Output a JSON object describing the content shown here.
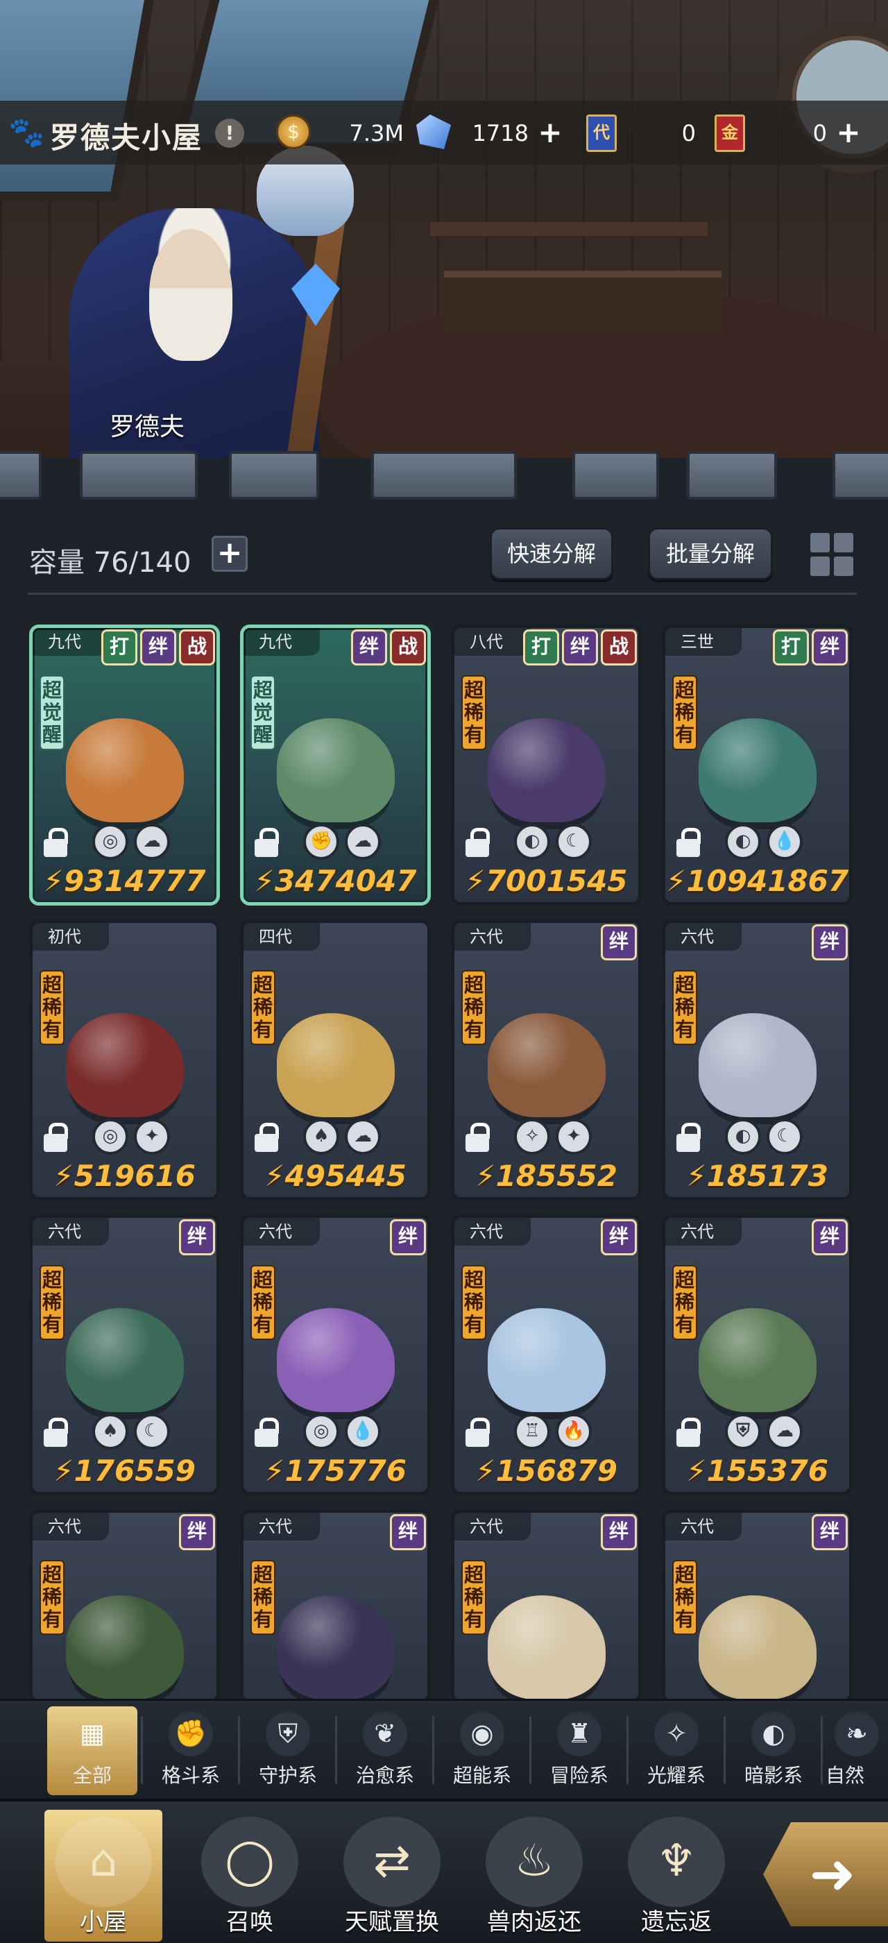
{
  "house": {
    "title": "罗德夫小屋",
    "info_glyph": "!",
    "character_name": "罗德夫"
  },
  "resources": {
    "gold": {
      "value": "7.3M",
      "icon": "gold-coin-icon"
    },
    "gems": {
      "value": "1718",
      "icon": "crystal-icon",
      "add": "+"
    },
    "card_blue": {
      "value": "0",
      "glyph": "代"
    },
    "card_red": {
      "value": "0",
      "glyph": "金",
      "add": "+"
    }
  },
  "inventory": {
    "capacity_label": "容量",
    "capacity_value": "76/140",
    "add": "+",
    "quick_decompose": "快速分解",
    "batch_decompose": "批量分解"
  },
  "badge_labels": {
    "fight": "打",
    "bond": "绊",
    "war": "战"
  },
  "rarity_labels": {
    "super_rare": "超稀有",
    "awakened": "超觉醒"
  },
  "power_icon": "⚡",
  "pets": [
    {
      "gen": "九代",
      "super": true,
      "rarity": "超觉醒",
      "badges": [
        "打",
        "绊",
        "战"
      ],
      "elements": [
        "◎",
        "☁"
      ],
      "power": "9314777",
      "color": "#c77a3a"
    },
    {
      "gen": "九代",
      "super": true,
      "rarity": "超觉醒",
      "badges": [
        "绊",
        "战"
      ],
      "elements": [
        "✊",
        "☁"
      ],
      "power": "3474047",
      "color": "#5e8a6a"
    },
    {
      "gen": "八代",
      "super": false,
      "rarity": "超稀有",
      "badges": [
        "打",
        "绊",
        "战"
      ],
      "elements": [
        "◐",
        "☾"
      ],
      "power": "7001545",
      "color": "#4a3b6b"
    },
    {
      "gen": "三世",
      "super": false,
      "rarity": "超稀有",
      "badges": [
        "打",
        "绊"
      ],
      "elements": [
        "◐",
        "💧"
      ],
      "power": "10941867",
      "color": "#3e7a72"
    },
    {
      "gen": "初代",
      "super": false,
      "rarity": "超稀有",
      "badges": [],
      "elements": [
        "◎",
        "✦"
      ],
      "power": "519616",
      "color": "#7a2c2c"
    },
    {
      "gen": "四代",
      "super": false,
      "rarity": "超稀有",
      "badges": [],
      "elements": [
        "♠",
        "☁"
      ],
      "power": "495445",
      "color": "#c9a253"
    },
    {
      "gen": "六代",
      "super": false,
      "rarity": "超稀有",
      "badges": [
        "绊"
      ],
      "elements": [
        "✧",
        "✦"
      ],
      "power": "185552",
      "color": "#8a5a3c"
    },
    {
      "gen": "六代",
      "super": false,
      "rarity": "超稀有",
      "badges": [
        "绊"
      ],
      "elements": [
        "◐",
        "☾"
      ],
      "power": "185173",
      "color": "#aeb6c9"
    },
    {
      "gen": "六代",
      "super": false,
      "rarity": "超稀有",
      "badges": [
        "绊"
      ],
      "elements": [
        "♠",
        "☾"
      ],
      "power": "176559",
      "color": "#3d6b5a"
    },
    {
      "gen": "六代",
      "super": false,
      "rarity": "超稀有",
      "badges": [
        "绊"
      ],
      "elements": [
        "◎",
        "💧"
      ],
      "power": "175776",
      "color": "#8a5fb6"
    },
    {
      "gen": "六代",
      "super": false,
      "rarity": "超稀有",
      "badges": [
        "绊"
      ],
      "elements": [
        "♖",
        "🔥"
      ],
      "power": "156879",
      "color": "#a9c4e0"
    },
    {
      "gen": "六代",
      "super": false,
      "rarity": "超稀有",
      "badges": [
        "绊"
      ],
      "elements": [
        "⛨",
        "☁"
      ],
      "power": "155376",
      "color": "#5a7a55"
    },
    {
      "gen": "六代",
      "super": false,
      "rarity": "超稀有",
      "badges": [
        "绊"
      ],
      "elements": [],
      "power": "",
      "color": "#3f5a3a"
    },
    {
      "gen": "六代",
      "super": false,
      "rarity": "超稀有",
      "badges": [
        "绊"
      ],
      "elements": [],
      "power": "",
      "color": "#3a3456"
    },
    {
      "gen": "六代",
      "super": false,
      "rarity": "超稀有",
      "badges": [
        "绊"
      ],
      "elements": [],
      "power": "",
      "color": "#d6c8a8"
    },
    {
      "gen": "六代",
      "super": false,
      "rarity": "超稀有",
      "badges": [
        "绊"
      ],
      "elements": [],
      "power": "",
      "color": "#c9b58a"
    }
  ],
  "categories": [
    {
      "label": "全部",
      "icon": "all-blocks-icon",
      "glyph": "▦",
      "active": true
    },
    {
      "label": "格斗系",
      "icon": "fist-icon",
      "glyph": "✊"
    },
    {
      "label": "守护系",
      "icon": "shield-icon",
      "glyph": "⛨"
    },
    {
      "label": "治愈系",
      "icon": "sprout-icon",
      "glyph": "❦"
    },
    {
      "label": "超能系",
      "icon": "alien-icon",
      "glyph": "◉"
    },
    {
      "label": "冒险系",
      "icon": "tower-icon",
      "glyph": "♜"
    },
    {
      "label": "光耀系",
      "icon": "star-cross-icon",
      "glyph": "✧"
    },
    {
      "label": "暗影系",
      "icon": "shadow-eye-icon",
      "glyph": "◐"
    },
    {
      "label": "自然",
      "icon": "leaf-icon",
      "glyph": "❧"
    }
  ],
  "nav": [
    {
      "label": "小屋",
      "icon": "house-icon",
      "glyph": "⌂",
      "active": true
    },
    {
      "label": "召唤",
      "icon": "egg-icon",
      "glyph": "◯"
    },
    {
      "label": "天赋置换",
      "icon": "swap-icon",
      "glyph": "⇄"
    },
    {
      "label": "兽肉返还",
      "icon": "meat-icon",
      "glyph": "♨"
    },
    {
      "label": "遗忘返",
      "icon": "flame-icon",
      "glyph": "♆"
    }
  ]
}
